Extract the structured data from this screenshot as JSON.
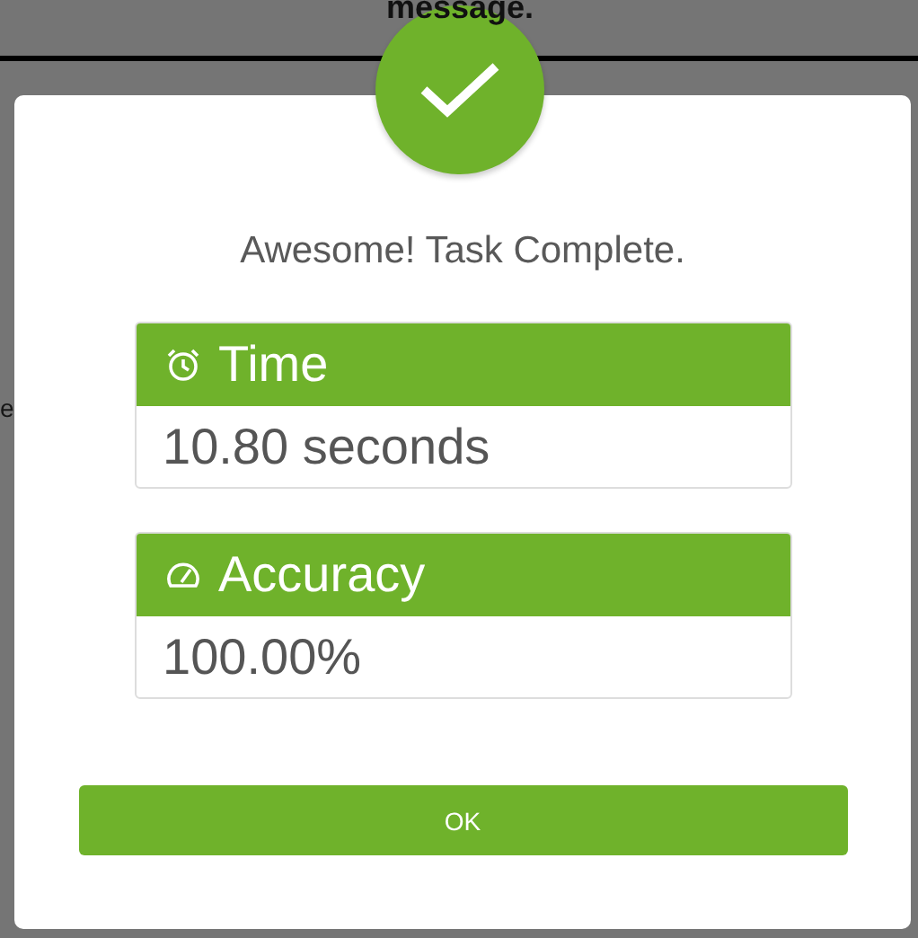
{
  "background": {
    "heading": "message.",
    "fragments": [
      "e"
    ]
  },
  "dialog": {
    "title": "Awesome! Task Complete.",
    "stats": [
      {
        "kind": "time",
        "label": "Time",
        "value": "10.80 seconds"
      },
      {
        "kind": "accuracy",
        "label": "Accuracy",
        "value": "100.00%"
      }
    ],
    "button": "OK"
  }
}
